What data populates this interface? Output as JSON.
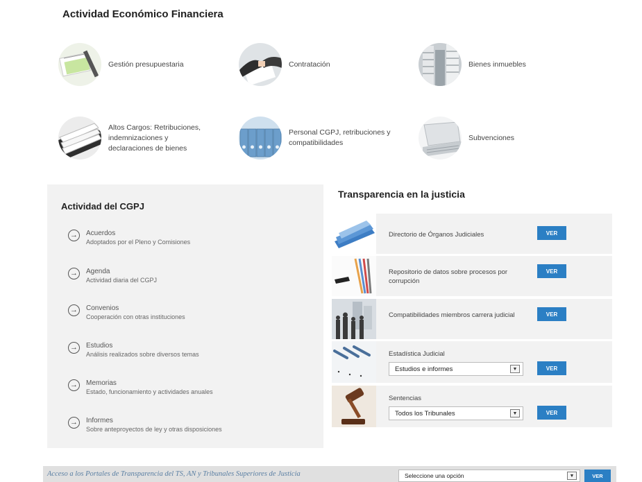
{
  "economic": {
    "title": "Actividad Económico Financiera",
    "items": [
      {
        "label": "Gestión presupuestaria",
        "icon": "budget-documents-image"
      },
      {
        "label": "Contratación",
        "icon": "contract-handshake-image"
      },
      {
        "label": "Bienes inmuebles",
        "icon": "building-image"
      },
      {
        "label": "Altos Cargos: Retribuciones, indemnizaciones y declaraciones de bienes",
        "icon": "paper-stack-image"
      },
      {
        "label": "Personal CGPJ, retribuciones y compatibilidades",
        "icon": "binders-image"
      },
      {
        "label": "Subvenciones",
        "icon": "laptop-image"
      }
    ]
  },
  "cgpj": {
    "title": "Actividad del CGPJ",
    "items": [
      {
        "name": "Acuerdos",
        "desc": "Adoptados por el Pleno y Comisiones"
      },
      {
        "name": "Agenda",
        "desc": "Actividad diaria del CGPJ"
      },
      {
        "name": "Convenios",
        "desc": "Cooperación con otras instituciones"
      },
      {
        "name": "Estudios",
        "desc": "Análisis realizados sobre diversos temas"
      },
      {
        "name": "Memorias",
        "desc": "Estado, funcionamiento y actividades anuales"
      },
      {
        "name": "Informes",
        "desc": "Sobre anteproyectos de ley y otras disposiciones"
      }
    ]
  },
  "justice": {
    "title": "Transparencia en la justicia",
    "ver_label": "VER",
    "rows": [
      {
        "label": "Directorio de Órganos Judiciales"
      },
      {
        "label": "Repositorio de datos sobre procesos por corrupción"
      },
      {
        "label": "Compatibilidades miembros carrera judicial"
      },
      {
        "label": "Estadística Judicial",
        "select_value": "Estudios e informes"
      },
      {
        "label": "Sentencias",
        "select_value": "Todos los Tribunales"
      }
    ]
  },
  "bottom": {
    "text": "Acceso a los Portales de Transparencia del TS, AN y Tribunales Superiores de Justicia",
    "select_value": "Seleccione una opción",
    "ver_label": "VER"
  }
}
